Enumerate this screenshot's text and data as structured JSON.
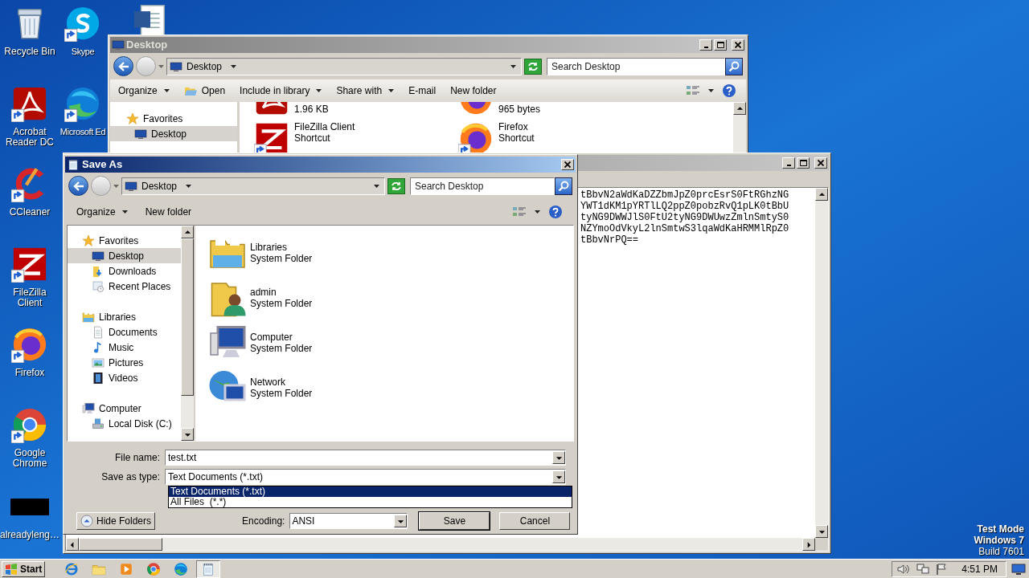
{
  "desktop": {
    "column_1": [
      {
        "kind": "recycle",
        "label": "Recycle Bin"
      },
      {
        "kind": "acrobat",
        "label": "Acrobat Reader DC"
      },
      {
        "kind": "ccleaner",
        "label": "CCleaner"
      },
      {
        "kind": "filezilla",
        "label": "FileZilla Client"
      },
      {
        "kind": "firefox",
        "label": "Firefox"
      },
      {
        "kind": "chrome",
        "label": "Google Chrome"
      },
      {
        "kind": "black",
        "label": "alreadyleng…"
      }
    ],
    "column_2": [
      {
        "kind": "skype",
        "label": "Skype"
      },
      {
        "kind": "edge",
        "label": "Microsoft Ed"
      }
    ],
    "column_3": [
      {
        "kind": "word"
      }
    ]
  },
  "explorer": {
    "title": "Desktop",
    "address": "Desktop",
    "search_placeholder": "Search Desktop",
    "toolbar": [
      {
        "kind": "menu",
        "label": "Organize"
      },
      {
        "kind": "open",
        "label": "Open"
      },
      {
        "kind": "menu",
        "label": "Include in library"
      },
      {
        "kind": "menu",
        "label": "Share with"
      },
      {
        "kind": "plain",
        "label": "E-mail"
      },
      {
        "kind": "plain",
        "label": "New folder"
      }
    ],
    "nav": [
      {
        "kind": "star",
        "label": "Favorites",
        "selected": false
      },
      {
        "kind": "desktop",
        "label": "Desktop",
        "selected": true
      }
    ],
    "files": [
      {
        "kind": "acrobat",
        "lines": [
          "1.96 KB"
        ]
      },
      {
        "kind": "firefox",
        "lines": [
          "965 bytes"
        ]
      },
      {
        "kind": "filezilla",
        "lines": [
          "FileZilla Client",
          "Shortcut"
        ]
      },
      {
        "kind": "firefox",
        "lines": [
          "Firefox",
          "Shortcut"
        ]
      }
    ]
  },
  "notepad": {
    "lines": [
      "tBbvN2aWdKaDZZbmJpZ0prcEsrS0FtRGhzNG",
      "YWT1dKM1pYRTlLQ2ppZ0pobzRvQ1pLK0tBbU",
      "tyNG9DWWJlS0FtU2tyNG9DWUwzZmlnSmtyS0",
      "NZYmoOdVkyL2lnSmtwS3lqaWdKaHRMMlRpZ0",
      "tBbvNrPQ=="
    ]
  },
  "save_dialog": {
    "title": "Save As",
    "address": "Desktop",
    "search_placeholder": "Search Desktop",
    "toolbar": [
      {
        "kind": "menu",
        "label": "Organize"
      },
      {
        "kind": "plain",
        "label": "New folder"
      }
    ],
    "nav": [
      {
        "kind": "star",
        "label": "Favorites",
        "selected": false,
        "children": [
          {
            "kind": "desktop",
            "label": "Desktop",
            "selected": true
          },
          {
            "kind": "downloads",
            "label": "Downloads",
            "selected": false
          },
          {
            "kind": "recent",
            "label": "Recent Places",
            "selected": false
          }
        ]
      },
      {
        "kind": "libraries",
        "label": "Libraries",
        "selected": false,
        "children": [
          {
            "kind": "documents",
            "label": "Documents",
            "selected": false
          },
          {
            "kind": "music",
            "label": "Music",
            "selected": false
          },
          {
            "kind": "pictures",
            "label": "Pictures",
            "selected": false
          },
          {
            "kind": "videos",
            "label": "Videos",
            "selected": false
          }
        ]
      },
      {
        "kind": "computer",
        "label": "Computer",
        "selected": false,
        "children": [
          {
            "kind": "disk",
            "label": "Local Disk (C:)",
            "selected": false
          }
        ]
      }
    ],
    "items": [
      {
        "kind": "libraries",
        "name": "Libraries",
        "type": "System Folder"
      },
      {
        "kind": "user",
        "name": "admin",
        "type": "System Folder"
      },
      {
        "kind": "computer",
        "name": "Computer",
        "type": "System Folder"
      },
      {
        "kind": "network",
        "name": "Network",
        "type": "System Folder"
      }
    ],
    "file_name_label": "File name:",
    "file_name": "test.txt",
    "type_label": "Save as type:",
    "type": "Text Documents (*.txt)",
    "type_options": [
      {
        "label": "Text Documents (*.txt)",
        "selected": true
      },
      {
        "label": "All Files  (*.*)",
        "selected": false
      }
    ],
    "hide_folders": "Hide Folders",
    "encoding_label": "Encoding:",
    "encoding": "ANSI",
    "save": "Save",
    "cancel": "Cancel"
  },
  "taskbar": {
    "start": "Start",
    "apps": [
      {
        "kind": "ie",
        "selected": false
      },
      {
        "kind": "folder",
        "selected": false
      },
      {
        "kind": "media",
        "selected": false
      },
      {
        "kind": "chrome",
        "selected": false
      },
      {
        "kind": "edge",
        "selected": false
      },
      {
        "kind": "notepad",
        "selected": true
      }
    ],
    "clock": "4:51 PM"
  },
  "os_notice": {
    "mode": "Test Mode",
    "edition": "Windows 7",
    "build": "Build 7601"
  }
}
